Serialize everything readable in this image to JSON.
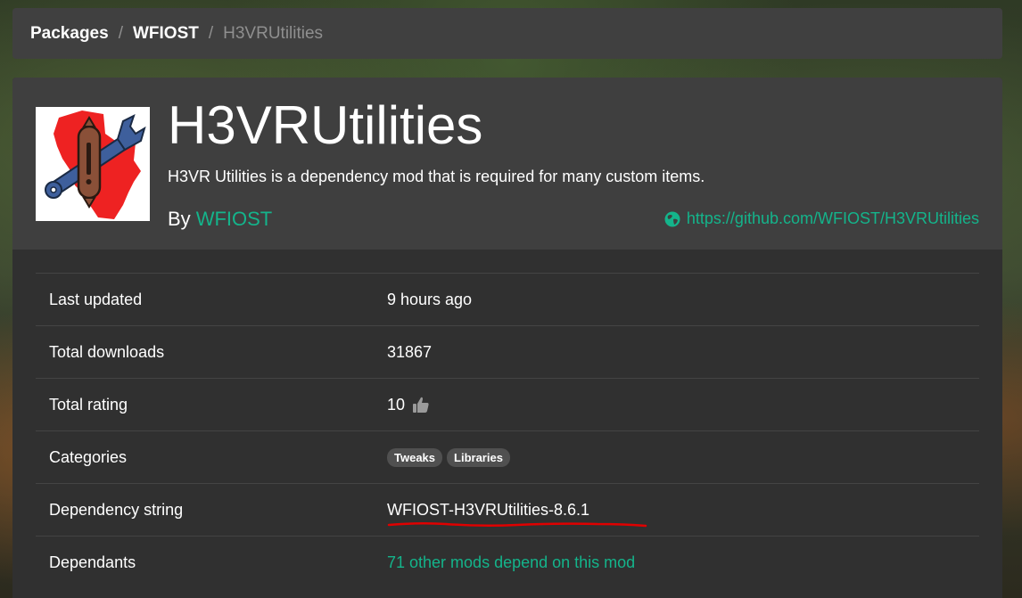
{
  "breadcrumb": {
    "items": [
      "Packages",
      "WFIOST"
    ],
    "separator": "/",
    "current": "H3VRUtilities"
  },
  "package": {
    "title": "H3VRUtilities",
    "description": "H3VR Utilities is a dependency mod that is required for many custom items.",
    "by_label": "By",
    "author": "WFIOST",
    "website": "https://github.com/WFIOST/H3VRUtilities",
    "icon": "wrench-sausage-icon"
  },
  "info": {
    "last_updated_label": "Last updated",
    "last_updated_value": "9 hours ago",
    "downloads_label": "Total downloads",
    "downloads_value": "31867",
    "rating_label": "Total rating",
    "rating_value": "10",
    "rating_icon": "thumbs-up-icon",
    "categories_label": "Categories",
    "categories": [
      "Tweaks",
      "Libraries"
    ],
    "dependency_label": "Dependency string",
    "dependency_value": "WFIOST-H3VRUtilities-8.6.1",
    "dependants_label": "Dependants",
    "dependants_value": "71 other mods depend on this mod"
  },
  "colors": {
    "accent": "#14b48b",
    "annotation": "#e00000"
  }
}
